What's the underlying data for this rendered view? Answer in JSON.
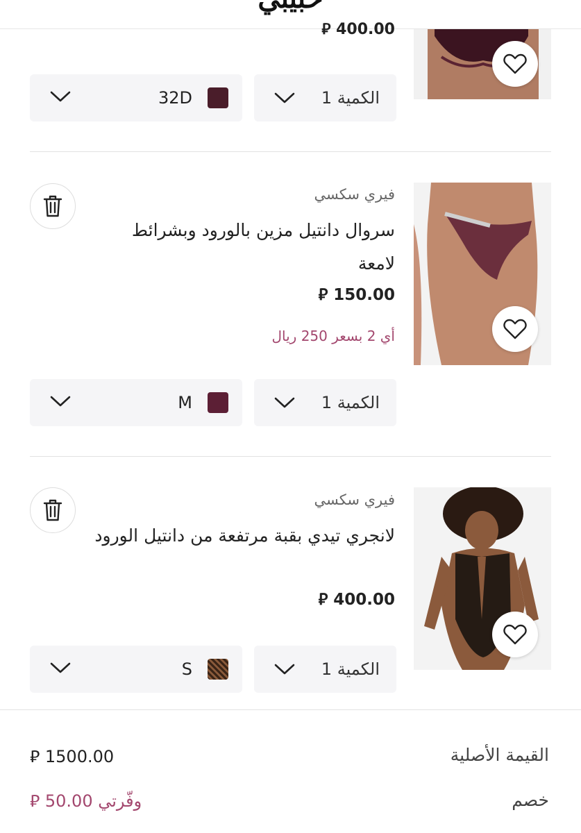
{
  "header": {
    "logo": "حبيبي"
  },
  "items": [
    {
      "price": "400.00 ⃁",
      "quantity": "الكمية 1",
      "size": "32D",
      "swatch_color": "#4a1d2a"
    },
    {
      "brand": "فيري سكسي",
      "title": "سروال دانتيل مزين بالورود وبشرائط لامعة",
      "price": "150.00 ⃁",
      "offer": "أي 2 بسعر 250 ريال",
      "quantity": "الكمية 1",
      "size": "M",
      "swatch_color": "#5c1f35"
    },
    {
      "brand": "فيري سكسي",
      "title": "لانجري تيدي بقبة مرتفعة من دانتيل الورود",
      "price": "400.00 ⃁",
      "quantity": "الكمية 1",
      "size": "S",
      "swatch_color": "#3a2416"
    }
  ],
  "summary": {
    "original_label": "القيمة الأصلية",
    "original_value": "1500.00 ⃁",
    "discount_label": "خصم",
    "discount_value": "وفّرتي 50.00 ⃁"
  },
  "colors": {
    "accent": "#a3476e",
    "box_bg": "#f5f5f7"
  },
  "icons": [
    "heart-icon",
    "trash-icon",
    "chevron-down-icon"
  ]
}
